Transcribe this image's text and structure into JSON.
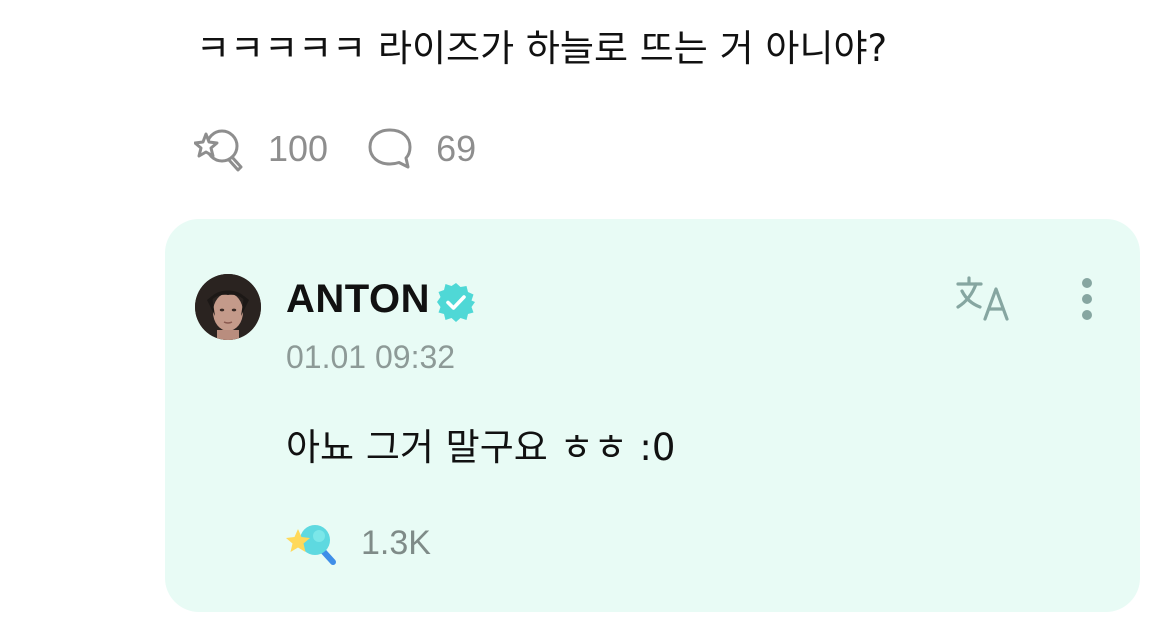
{
  "post": {
    "text": "ㅋㅋㅋㅋㅋ 라이즈가 하늘로 뜨는 거 아니야?",
    "reaction_count": "100",
    "comment_count": "69",
    "reaction_icon": "star-lollipop-outline-icon",
    "comment_icon": "speech-bubble-icon"
  },
  "reply": {
    "author": "ANTON",
    "verified_icon": "verified-badge-icon",
    "timestamp": "01.01 09:32",
    "text": "아뇨 그거 말구요 ㅎㅎ :0",
    "reaction_count": "1.3K",
    "reaction_icon": "star-lollipop-filled-icon",
    "translate_icon": "translate-icon",
    "more_icon": "more-vertical-icon",
    "avatar": "avatar"
  },
  "colors": {
    "card_background": "#e8fbf5",
    "verified": "#4fd8d6",
    "muted_text": "#8d9a97",
    "icon_gray": "#8e8e8e"
  }
}
